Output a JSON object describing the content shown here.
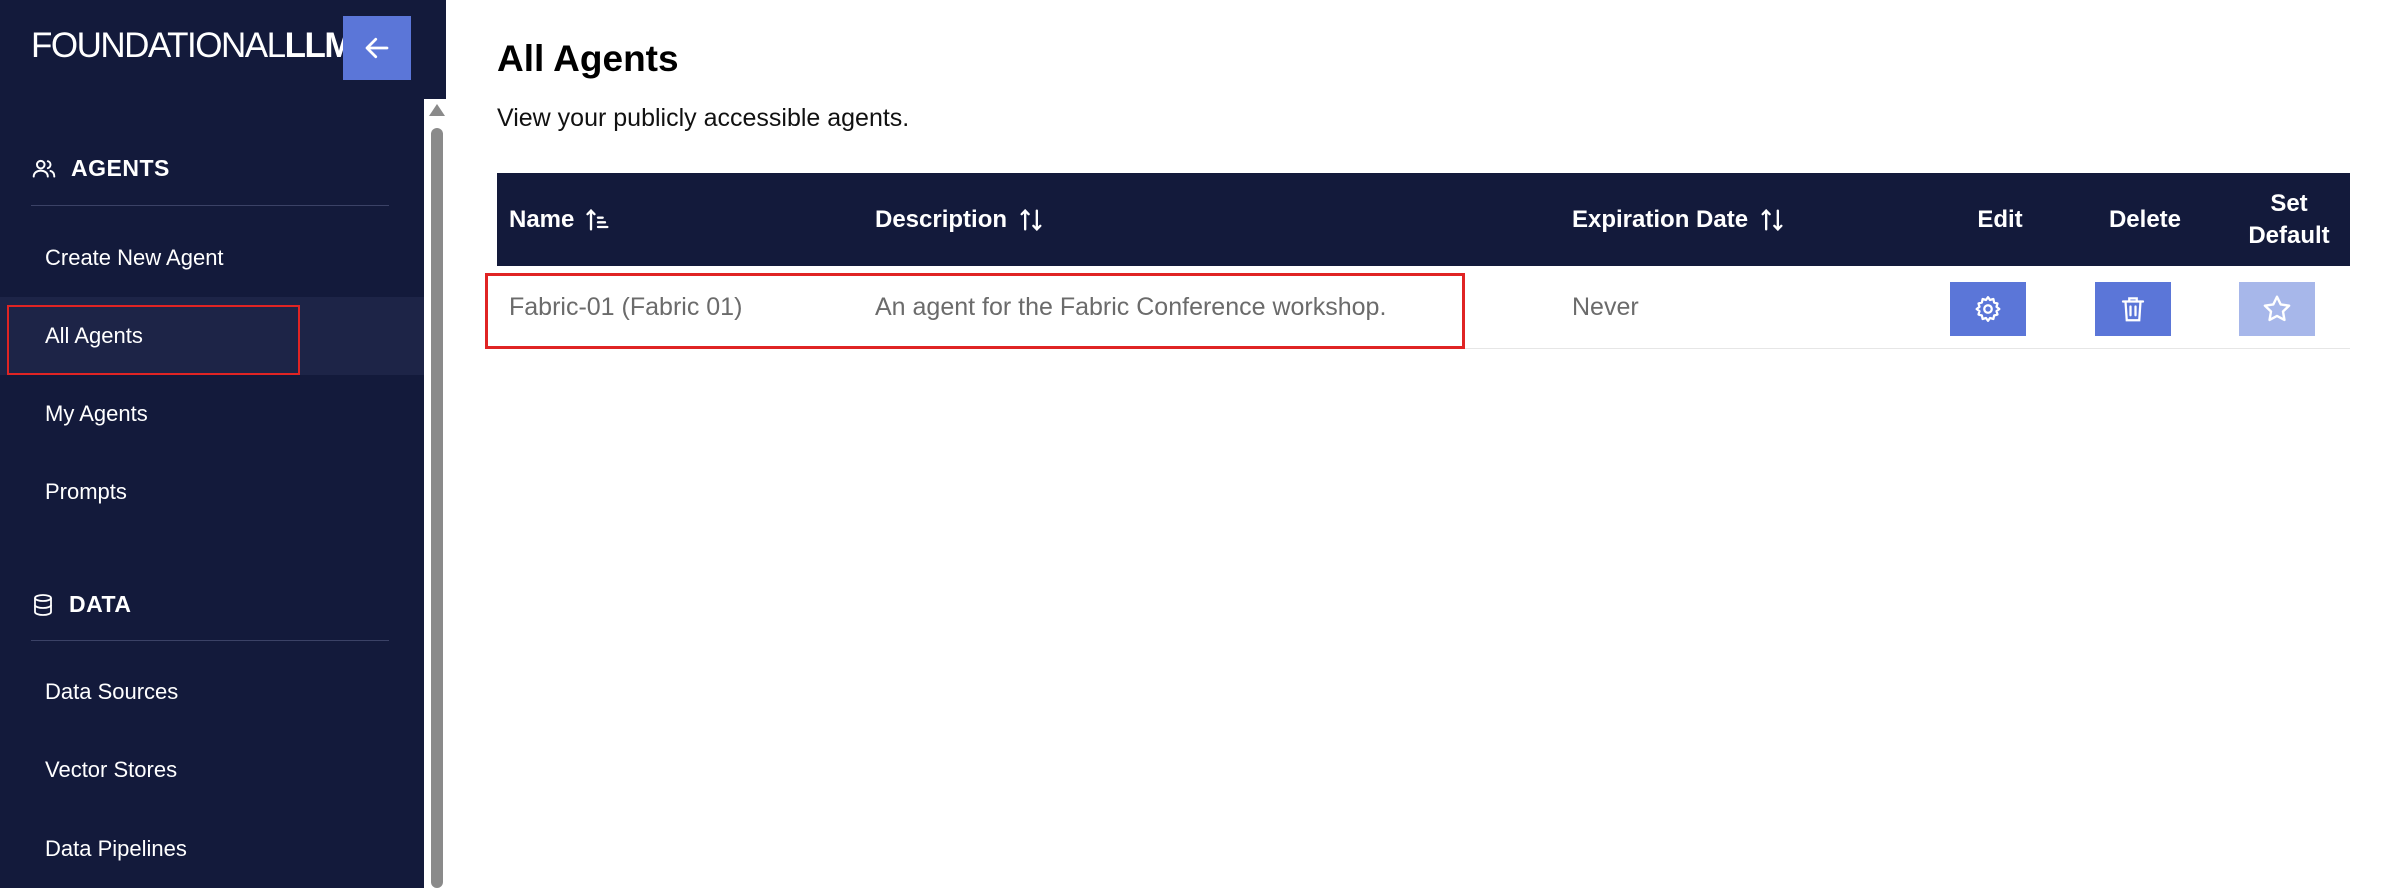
{
  "brand": {
    "light": "FOUNDATIONAL",
    "bold": "LLM"
  },
  "sidebar": {
    "sections": [
      {
        "title": "AGENTS",
        "items": [
          "Create New Agent",
          "All Agents",
          "My Agents",
          "Prompts"
        ]
      },
      {
        "title": "DATA",
        "items": [
          "Data Sources",
          "Vector Stores",
          "Data Pipelines"
        ]
      }
    ],
    "active_item": "All Agents"
  },
  "page": {
    "title": "All Agents",
    "subtitle": "View your publicly accessible agents."
  },
  "table": {
    "columns": {
      "name": "Name",
      "description": "Description",
      "expiration": "Expiration Date",
      "edit": "Edit",
      "delete": "Delete",
      "set_default_1": "Set",
      "set_default_2": "Default"
    },
    "rows": [
      {
        "name": "Fabric-01 (Fabric 01)",
        "description": "An agent for the Fabric Conference workshop.",
        "expiration": "Never"
      }
    ]
  },
  "colors": {
    "sidebar_bg": "#131a3b",
    "accent": "#5b76d8",
    "highlight": "#e02424"
  },
  "icons": {
    "collapse": "arrow-left-icon",
    "agents": "users-icon",
    "data": "database-icon",
    "edit": "gear-icon",
    "delete": "trash-icon",
    "default": "star-icon"
  }
}
